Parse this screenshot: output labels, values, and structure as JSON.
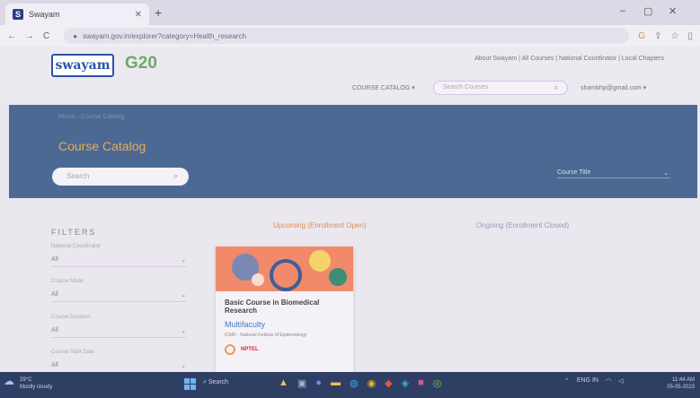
{
  "browser": {
    "tab_title": "Swayam",
    "tab_favicon": "S",
    "new_tab": "+",
    "url": "swayam.gov.in/explorer?category=Health_research",
    "controls": [
      "–",
      "▢",
      "✕"
    ]
  },
  "site": {
    "logo_text": "swayam",
    "g20_text": "G20",
    "top_links": "About Swayam | All Courses | National Coordinator | Local Chapters",
    "catalog_button": "COURSE CATALOG ▾",
    "search_placeholder": "Search Courses",
    "user_email": "shambhp@gmail.com ▾"
  },
  "banner": {
    "breadcrumb": "Home  ›  Course Catalog",
    "title": "Course Catalog",
    "search_placeholder": "Search",
    "sort_label": "Course Title",
    "bg_color": "#4c6993",
    "title_color": "#e7a95a"
  },
  "filters": {
    "title": "FILTERS",
    "items": [
      {
        "label": "National Coordinator",
        "value": "All"
      },
      {
        "label": "Course Mode",
        "value": "All"
      },
      {
        "label": "Course Duration",
        "value": "All"
      },
      {
        "label": "Course Start Date",
        "value": "All"
      }
    ]
  },
  "tabs": {
    "upcoming": "Upcoming (Enrollment Open)",
    "ongoing": "Ongoing (Enrollment Closed)"
  },
  "card": {
    "title": "Basic Course in Biomedical Research",
    "instructor": "Multifaculty",
    "org": "ICMR - National Institute of Epidemiology",
    "badge": "NPTEL"
  },
  "taskbar": {
    "weather_temp": "29°C",
    "weather_desc": "Mostly cloudy",
    "search_label": "Search",
    "tray_lang": "ENG IN",
    "time": "11:44 AM",
    "date": "05-05-2023"
  },
  "icons": {
    "back": "←",
    "forward": "→",
    "reload": "C",
    "lock": "●",
    "search": "⌕",
    "caret": "⌄",
    "weather": "☁"
  }
}
